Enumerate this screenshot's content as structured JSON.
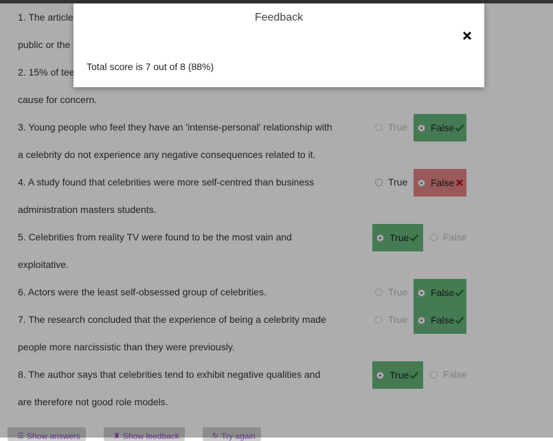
{
  "questions": [
    {
      "lines": [
        "1. The article",
        "public or the"
      ],
      "hidden": true
    },
    {
      "lines": [
        "2. 15% of tee",
        "cause for concern."
      ],
      "hidden": true
    },
    {
      "lines": [
        "3. Young people who feel they have an 'intense-personal' relationship with",
        "a celebrity do not experience any negative consequences related to it."
      ],
      "selected": "False",
      "result": "correct"
    },
    {
      "lines": [
        "4. A study found that celebrities were more self-centred than business",
        "administration masters students."
      ],
      "selected": "False",
      "result": "wrong"
    },
    {
      "lines": [
        "5. Celebrities from reality TV were found to be the most vain and",
        "exploitative."
      ],
      "selected": "True",
      "result": "correct"
    },
    {
      "lines": [
        "6. Actors were the least self-obsessed group of celebrities."
      ],
      "selected": "False",
      "result": "correct"
    },
    {
      "lines": [
        "7. The research concluded that the experience of being a celebrity made",
        "people more narcissistic than they were previously."
      ],
      "selected": "False",
      "result": "correct"
    },
    {
      "lines": [
        "8. The author says that celebrities tend to exhibit negative qualities and",
        "are therefore not good role models."
      ],
      "selected": "True",
      "result": "correct"
    }
  ],
  "option_labels": {
    "true": "True",
    "false": "False"
  },
  "buttons": {
    "show_answers": "Show answers",
    "show_feedback": "Show feedback",
    "try_again": "Try again"
  },
  "modal": {
    "title": "Feedback",
    "body": "Total score is 7 out of 8 (88%)"
  },
  "colors": {
    "correct": "#66b57b",
    "wrong": "#e48282",
    "overlay": "rgba(0,0,0,0.32)",
    "button_text": "#8a4bbd"
  }
}
